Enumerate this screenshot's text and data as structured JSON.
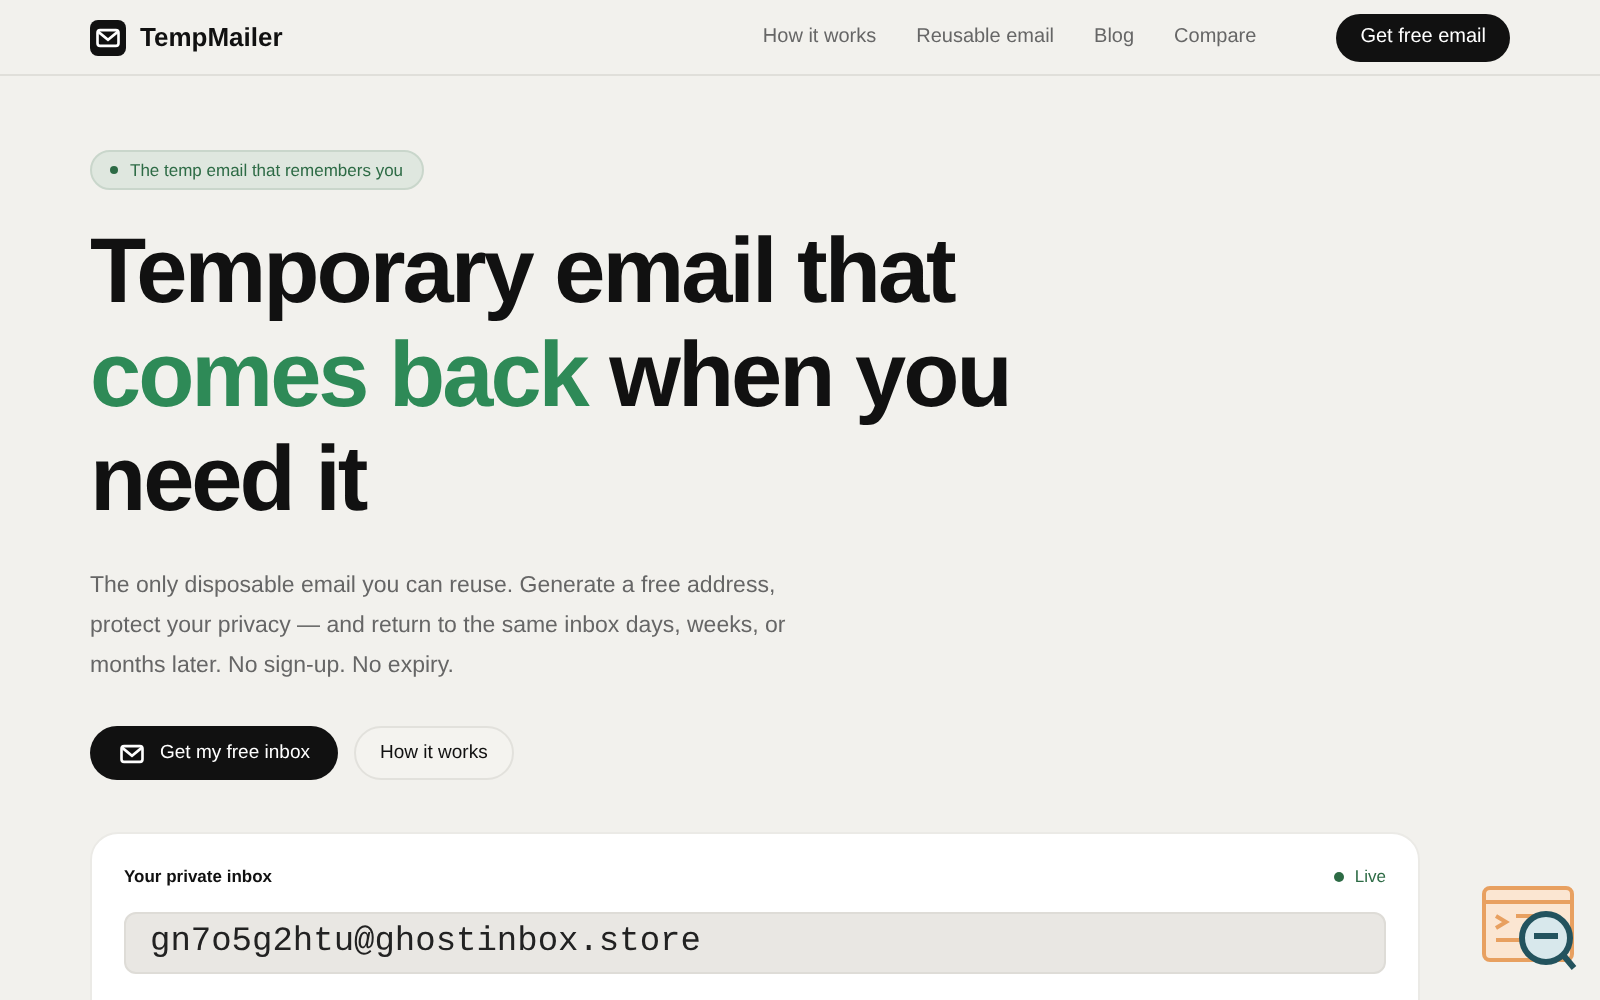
{
  "brand": "TempMailer",
  "nav": [
    "How it works",
    "Reusable email",
    "Blog",
    "Compare"
  ],
  "nav_cta": "Get free email",
  "badge": "The temp email that remembers you",
  "headline": {
    "before": "Temporary email that",
    "accent": "comes back",
    "after": "when you need it"
  },
  "lead": "The only disposable email you can reuse. Generate a free address, protect your privacy — and return to the same inbox days, weeks, or months later. No sign-up. No expiry.",
  "buttons": [
    {
      "label": "Get my free inbox",
      "kind": "primary"
    },
    {
      "label": "How it works",
      "kind": "secondary"
    }
  ],
  "inbox": {
    "title": "Your private inbox",
    "status": "Live",
    "address": "gn7o5g2htu@ghostinbox.store"
  }
}
